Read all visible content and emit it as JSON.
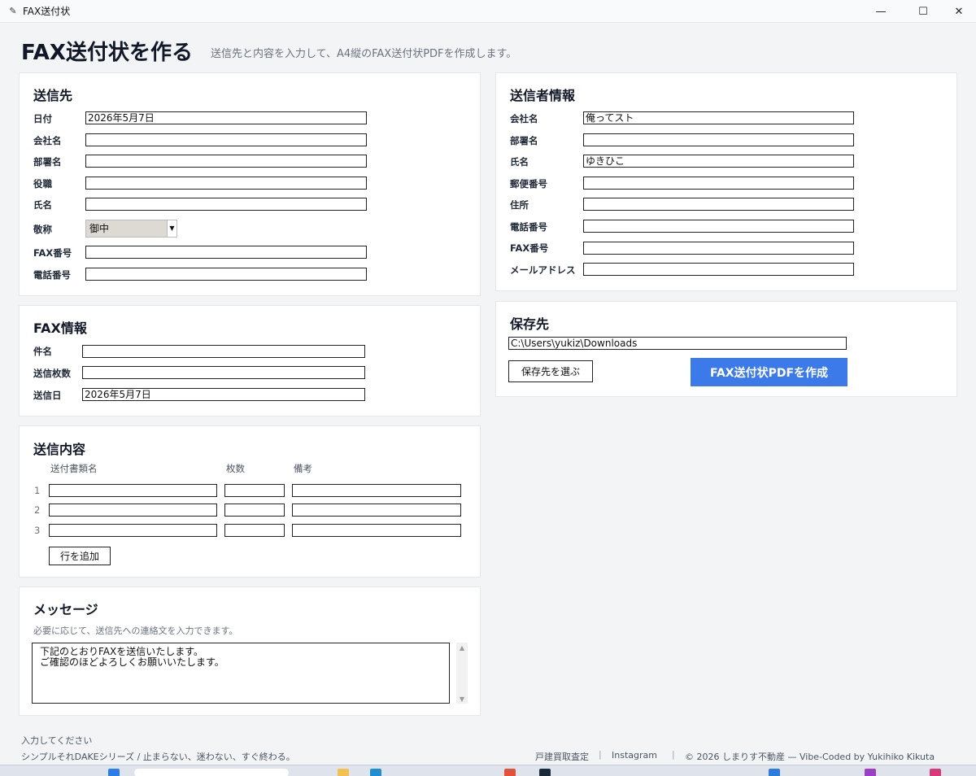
{
  "window": {
    "title": "FAX送付状"
  },
  "header": {
    "title": "FAX送付状を作る",
    "subtitle": "送信先と内容を入力して、A4縦のFAX送付状PDFを作成します。"
  },
  "recipient": {
    "title": "送信先",
    "date_label": "日付",
    "date_value": "2026年5月7日",
    "company_label": "会社名",
    "company_value": "",
    "department_label": "部署名",
    "department_value": "",
    "position_label": "役職",
    "position_value": "",
    "name_label": "氏名",
    "name_value": "",
    "honorific_label": "敬称",
    "honorific_value": "御中",
    "fax_label": "FAX番号",
    "fax_value": "",
    "phone_label": "電話番号",
    "phone_value": ""
  },
  "fax_info": {
    "title": "FAX情報",
    "subject_label": "件名",
    "subject_value": "",
    "pages_label": "送信枚数",
    "pages_value": "",
    "send_date_label": "送信日",
    "send_date_value": "2026年5月7日"
  },
  "contents": {
    "title": "送信内容",
    "columns": [
      "送付書類名",
      "枚数",
      "備考"
    ],
    "rows": [
      {
        "num": "1",
        "doc": "",
        "count": "",
        "note": ""
      },
      {
        "num": "2",
        "doc": "",
        "count": "",
        "note": ""
      },
      {
        "num": "3",
        "doc": "",
        "count": "",
        "note": ""
      }
    ],
    "add_row_label": "行を追加"
  },
  "message": {
    "title": "メッセージ",
    "hint": "必要に応じて、送信先への連絡文を入力できます。",
    "value": "下記のとおりFAXを送信いたします。\nご確認のほどよろしくお願いいたします。"
  },
  "sender": {
    "title": "送信者情報",
    "company_label": "会社名",
    "company_value": "俺ってスト",
    "department_label": "部署名",
    "department_value": "",
    "name_label": "氏名",
    "name_value": "ゆきひこ",
    "zip_label": "郵便番号",
    "zip_value": "",
    "address_label": "住所",
    "address_value": "",
    "phone_label": "電話番号",
    "phone_value": "",
    "fax_label": "FAX番号",
    "fax_value": "",
    "email_label": "メールアドレス",
    "email_value": ""
  },
  "save": {
    "title": "保存先",
    "path_value": "C:\\Users\\yukiz\\Downloads",
    "choose_label": "保存先を選ぶ",
    "create_label": "FAX送付状PDFを作成"
  },
  "footer": {
    "status": "入力してください",
    "tagline": "シンプルそれDAKEシリーズ / 止まらない、迷わない、すぐ終わる。",
    "link1": "戸建買取査定",
    "link2": "Instagram",
    "copyright": "© 2026 しまりす不動産 — Vibe-Coded by Yukihiko Kikuta",
    "separator": "|"
  },
  "colors": {
    "primary": "#3b7ae8",
    "background": "#f3f4f6",
    "card": "#ffffff"
  }
}
